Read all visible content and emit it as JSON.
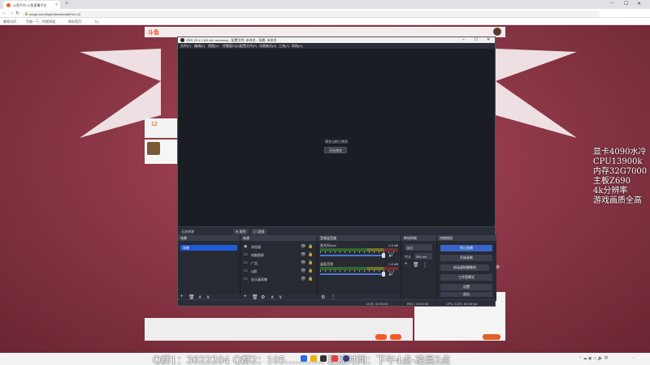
{
  "browser": {
    "tab_title": "斗鱼平台-斗鱼直播平台",
    "tab_close": "×",
    "new_tab": "+",
    "url": "douyu.com/topic/diamondpfl?rid=12",
    "bookmarks": [
      "最常访问",
      "百度一下，你就知道",
      "新标签页",
      "Try"
    ],
    "controls": [
      "‒",
      "☐",
      "✕"
    ],
    "nav": [
      "←",
      "→",
      "↻"
    ]
  },
  "page": {
    "logo": "斗鱼",
    "side_number": "12",
    "top_scroll": "…………………………………………"
  },
  "specs_overlay": [
    "显卡4090水冷",
    "CPU13900k",
    "内存32G7000",
    "主板Z690",
    "4k分辨率",
    "游戏画质全高"
  ],
  "obs": {
    "title": "OBS 29.1.3 (64-bit, windows) - 配置文件: 未命名 - 场景: 未命名",
    "menu": [
      "文件(F)",
      "编辑(E)",
      "视图(V)",
      "停靠窗口(D)",
      "配置文件(P)",
      "场景集合(S)",
      "工具(T)",
      "帮助(H)"
    ],
    "preview_message": "预览当前已禁用",
    "preview_button": "开启预览",
    "context_label": "无选择源",
    "tab_properties": "属性",
    "tab_filters": "滤镜",
    "docks": {
      "scenes": "场景",
      "sources": "来源",
      "mixer": "音频混音器",
      "transitions": "转场特效",
      "controls": "控制按钮"
    },
    "scene_item": "场景",
    "sources": [
      {
        "icon": "◉",
        "label": "浏览器"
      },
      {
        "icon": "▭",
        "label": "电脑图屏"
      },
      {
        "icon": "▭",
        "label": "广告"
      },
      {
        "icon": "▭",
        "label": "Q群"
      },
      {
        "icon": "▭",
        "label": "显示器采集"
      }
    ],
    "mixer": [
      {
        "name": "麦克风/Aux",
        "db": "0.0 dB"
      },
      {
        "name": "桌面音频",
        "db": "0.0 dB"
      }
    ],
    "transition_select": "淡出",
    "transition_duration_label": "时长",
    "transition_duration": "300 ms",
    "control_buttons": [
      "停止直播",
      "开始录制",
      "启动虚拟摄像机",
      "工作室模式",
      "设置",
      "退出"
    ],
    "status": {
      "live": "LIVE: 00:00:00",
      "rec": "REC: 00:00:00",
      "cpu": "CPU: 0.3%, 60.00 fps"
    },
    "window_controls": [
      "‒",
      "☐",
      "✕"
    ]
  },
  "ticker": "Q群1：3622204   Q群2：105…………   直播时间：下午4点-凌晨2点",
  "tray_time": "…"
}
